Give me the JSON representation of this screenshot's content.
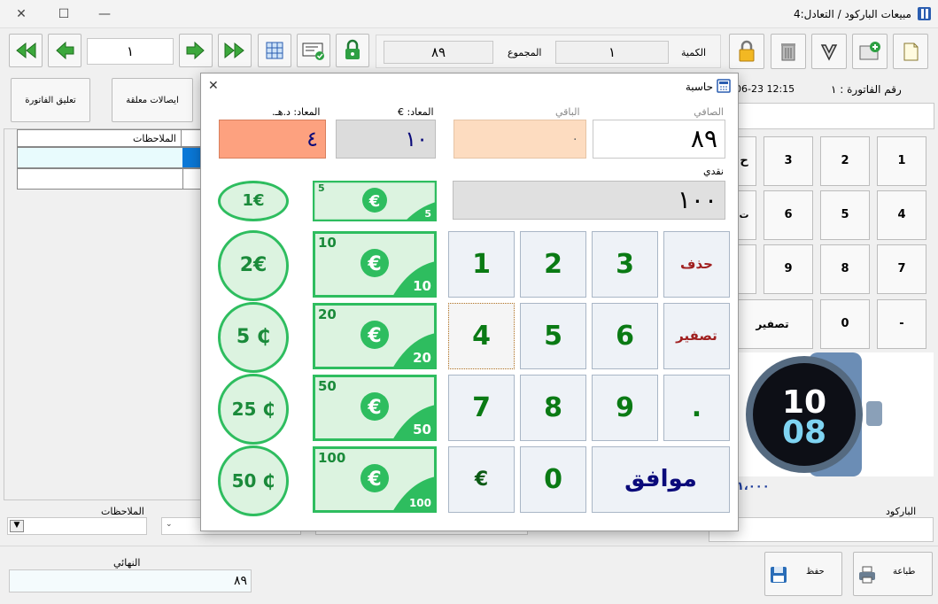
{
  "window": {
    "title": "مبيعات الباركود / التعادل:4",
    "minimize": "—",
    "maximize": "☐",
    "close": "✕"
  },
  "toolbar": {
    "page_number": "١",
    "total_label": "المجموع",
    "total_value": "٨٩",
    "quantity_label": "الكمية",
    "quantity_value": "١"
  },
  "left_buttons": {
    "hold_invoice": "تعليق الفاتورة",
    "held_receipts": "ايصالات معلقة"
  },
  "table": {
    "notes_header": "الملاحظات"
  },
  "invoice": {
    "number_label": "رقم الفاتورة : ١",
    "datetime": "06-23 12:15",
    "price": "١،٠٠٠"
  },
  "keypad": {
    "keys": [
      "1",
      "2",
      "3",
      "ح",
      "4",
      "5",
      "6",
      "ت",
      "7",
      "8",
      "9",
      "",
      "-",
      "0",
      "تصفير"
    ]
  },
  "bottom": {
    "notes_label": "الملاحظات",
    "final_label": "النهائي",
    "final_value": "٨٩",
    "barcode_label": "الباركود",
    "save_label": "حفظ",
    "print_label": "طباعة"
  },
  "calculator": {
    "title": "حاسبة",
    "close": "✕",
    "net_label": "الصافي",
    "net_value": "٨٩",
    "remaining_label": "الباقي",
    "remaining_value": "٠",
    "change_eur_label": "المعاد: €",
    "change_eur_value": "١٠",
    "change_aed_label": "المعاد: د.هـ.",
    "change_aed_value": "٤",
    "cash_label": "نقدي",
    "cash_value": "١٠٠",
    "keys": {
      "k1": "1",
      "k2": "2",
      "k3": "3",
      "k4": "4",
      "k5": "5",
      "k6": "6",
      "k7": "7",
      "k8": "8",
      "k9": "9",
      "k0": "0",
      "dot": ".",
      "euro": "€",
      "delete": "حذف",
      "reset": "تصفير",
      "ok": "موافق"
    },
    "notes": [
      "5",
      "10",
      "20",
      "50",
      "100"
    ],
    "coins": [
      "1€",
      "2€",
      "5 ₵",
      "25 ₵",
      "50 ₵"
    ]
  },
  "colors": {
    "accent": "#1a8a3a",
    "note_green": "#2ebd5f",
    "note_bg": "#dcf3e0",
    "change_aed_bg": "#fda17f",
    "remaining_bg": "#fddcc0",
    "key_blue": "#0a0a7a",
    "key_red": "#a02020"
  }
}
